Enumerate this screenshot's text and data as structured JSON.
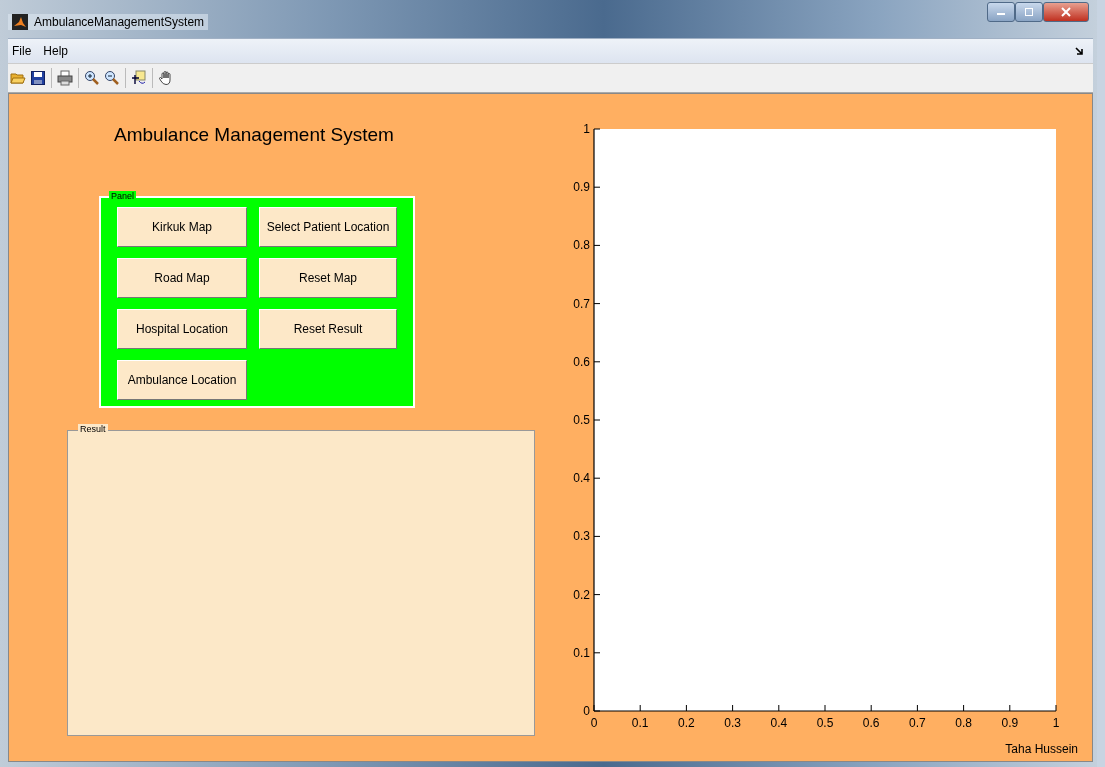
{
  "window": {
    "title": "AmbulanceManagementSystem"
  },
  "menu": [
    "File",
    "Help"
  ],
  "heading": "Ambulance Management System",
  "panel": {
    "title": "Panel",
    "buttons": [
      "Kirkuk Map",
      "Select Patient Location",
      "Road Map",
      "Reset Map",
      "Hospital Location",
      "Reset Result",
      "Ambulance Location"
    ]
  },
  "result": {
    "title": "Result"
  },
  "chart_data": {
    "type": "line",
    "xlim": [
      0,
      1
    ],
    "ylim": [
      0,
      1
    ],
    "xticks": [
      0,
      0.1,
      0.2,
      0.3,
      0.4,
      0.5,
      0.6,
      0.7,
      0.8,
      0.9,
      1
    ],
    "yticks": [
      0,
      0.1,
      0.2,
      0.3,
      0.4,
      0.5,
      0.6,
      0.7,
      0.8,
      0.9,
      1
    ]
  },
  "author": "Taha Hussein"
}
